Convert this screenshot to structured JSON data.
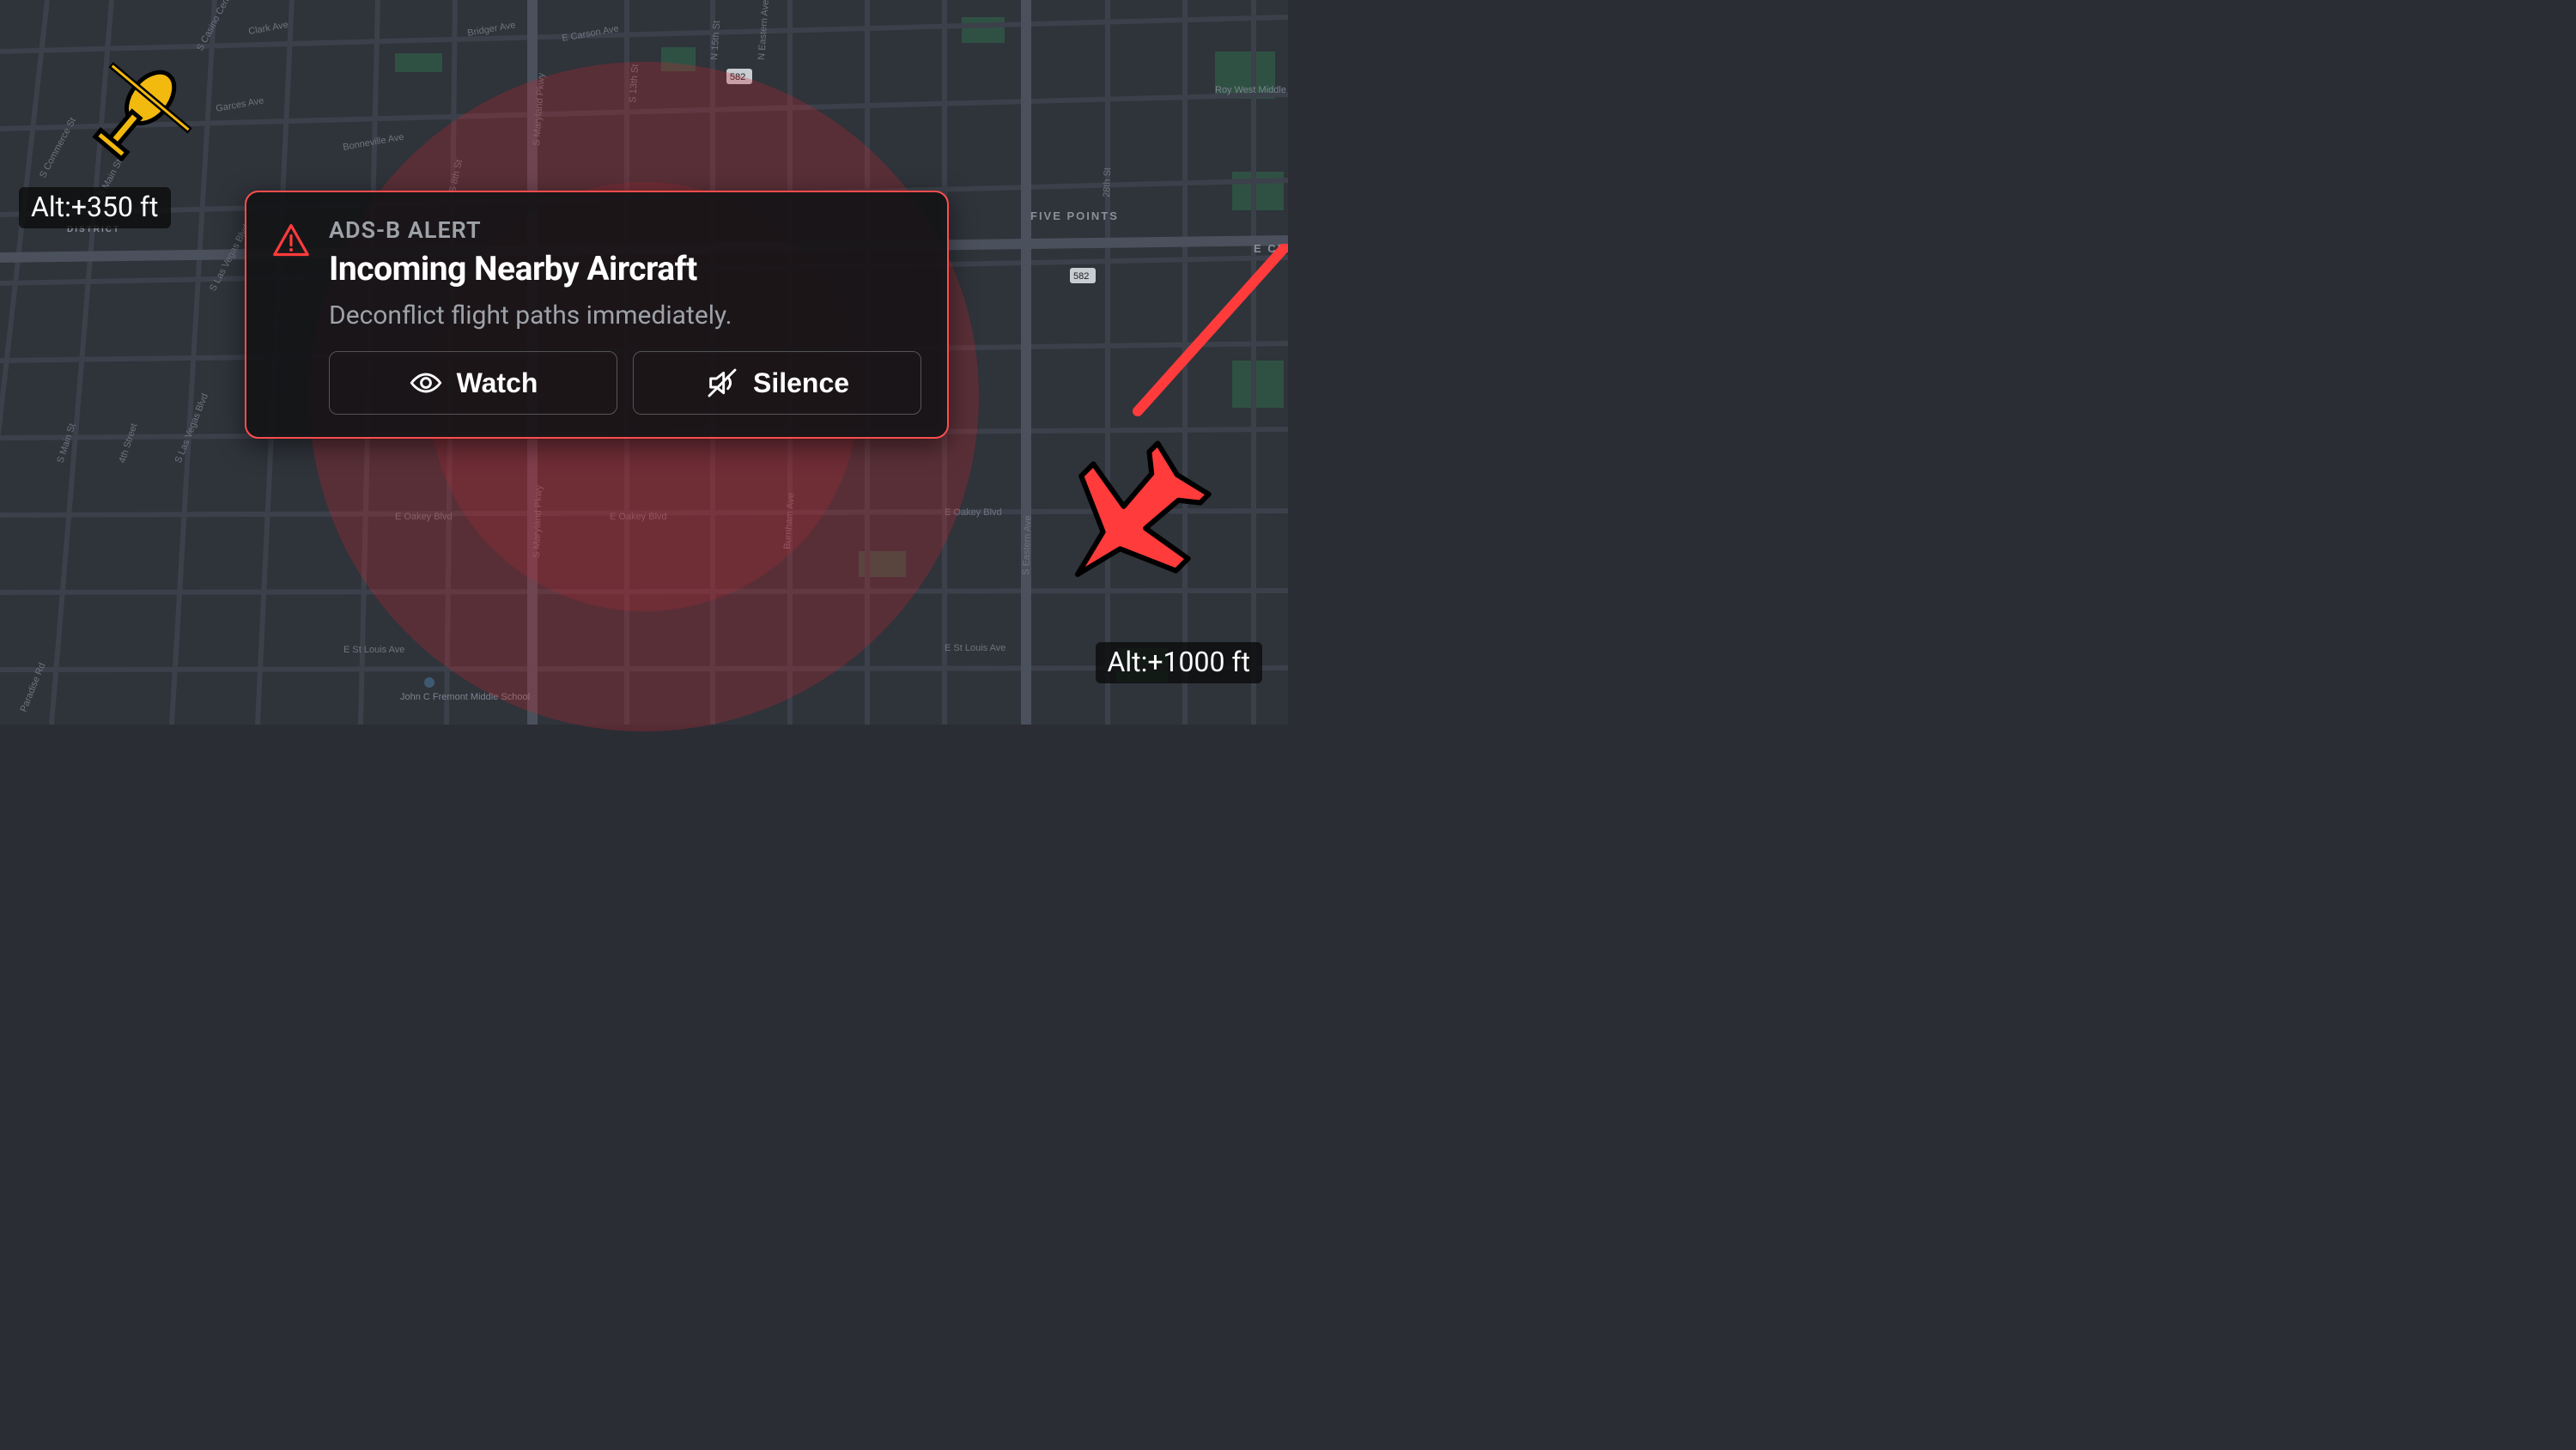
{
  "aircraft": {
    "helicopter": {
      "altitude_label": "Alt:+350 ft"
    },
    "airplane": {
      "altitude_label": "Alt:+1000 ft"
    }
  },
  "alert": {
    "category": "ADS-B ALERT",
    "title": "Incoming Nearby Aircraft",
    "body": "Deconflict flight paths immediately.",
    "buttons": {
      "watch": "Watch",
      "silence": "Silence"
    }
  },
  "map": {
    "streets": [
      "S Commerce St",
      "S Main St",
      "S Casino Center Blvd",
      "Clark Ave",
      "Garces Ave",
      "Bonneville Ave",
      "S 8th St",
      "Bridger Ave",
      "S Maryland Pkwy",
      "E Carson Ave",
      "S 13th St",
      "N 15th St",
      "N Eastern Ave",
      "S Las Vegas Blvd",
      "4th Street",
      "E Oakey Blvd",
      "Burnham Ave",
      "S Eastern Ave",
      "E St Louis Ave",
      "Paradise Rd",
      "28th St"
    ],
    "pois": [
      "Roy West Middle School",
      "John C Fremont Middle School"
    ],
    "labels": [
      "FIVE POINTS",
      "E Charleston Blvd",
      "DISTRICT"
    ],
    "route_shields": [
      "582",
      "582"
    ]
  }
}
